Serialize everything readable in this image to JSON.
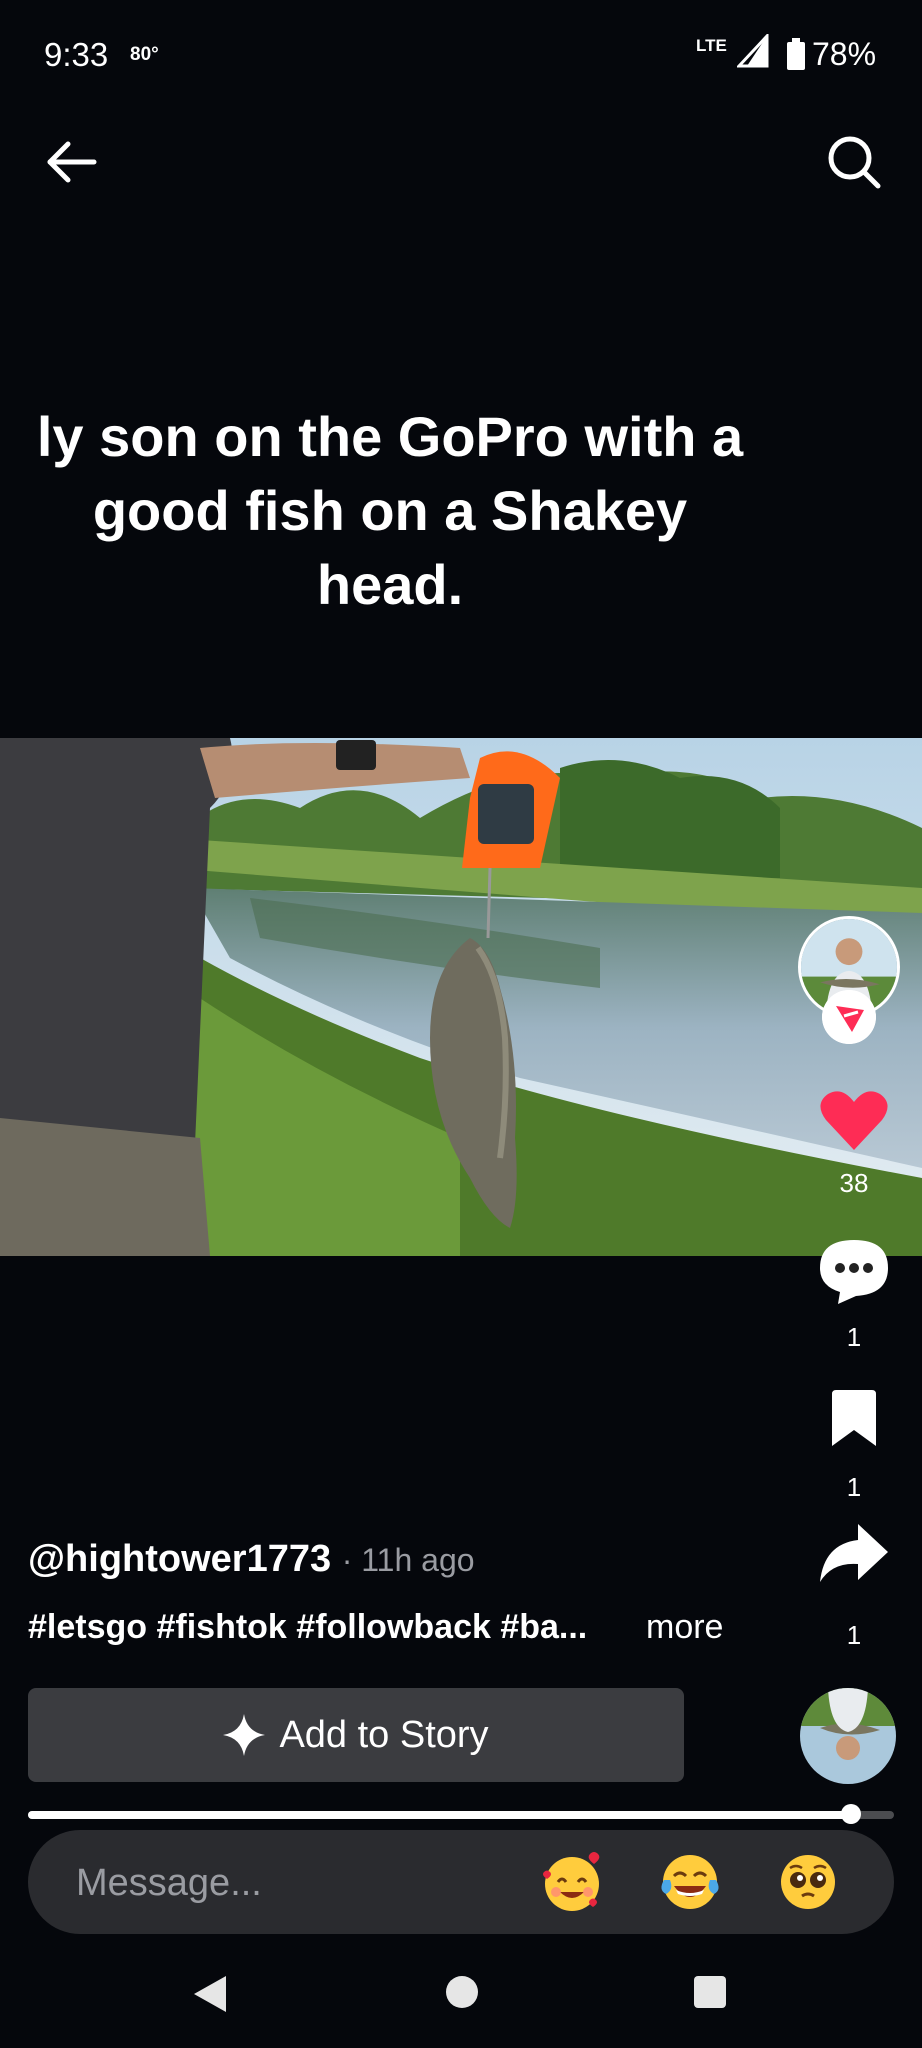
{
  "status_bar": {
    "time": "9:33",
    "temperature": "80°",
    "network": "LTE",
    "battery": "78%"
  },
  "header": {
    "back_icon": "arrow-left-icon",
    "search_icon": "search-icon"
  },
  "video": {
    "caption_lines": [
      "ly son on the GoPro with a",
      "good fish on a Shakey",
      "head."
    ]
  },
  "actions": {
    "likes": "38",
    "comments": "1",
    "saves": "1",
    "shares": "1",
    "like_color": "#fe2c55"
  },
  "post": {
    "author": "@hightower1773",
    "time_ago": "· 11h ago",
    "hashtags": "#letsgo #fishtok #followback #ba...",
    "more": "more"
  },
  "add_to_story": {
    "label": "Add to Story"
  },
  "playback": {
    "progress": 0.95
  },
  "message": {
    "placeholder": "Message...",
    "emojis": [
      "smiling-face-with-hearts",
      "face-with-tears-of-joy",
      "pleading-face"
    ]
  }
}
